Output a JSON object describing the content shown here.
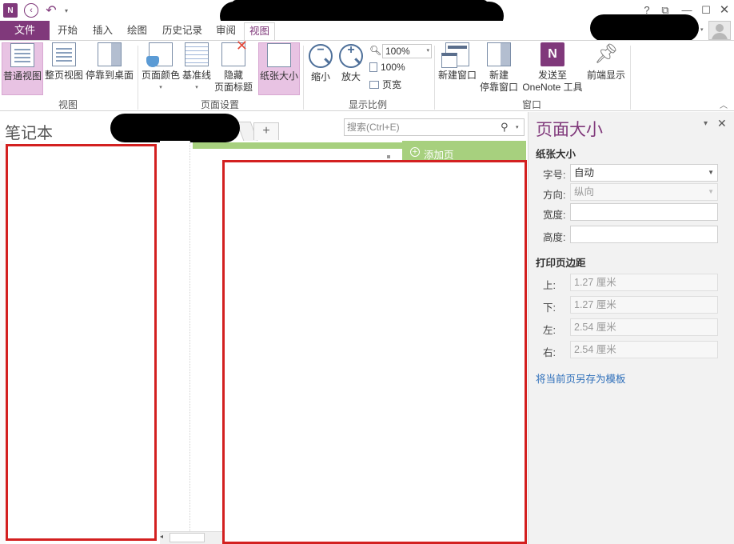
{
  "titlebar": {
    "app_logo": "N",
    "back_icon": "back-icon",
    "undo_icon": "undo-icon",
    "help": "?",
    "restore_ribbon": "⧉",
    "minimize": "—",
    "maximize": "☐",
    "close": "✕"
  },
  "tabs": {
    "file": "文件",
    "home": "开始",
    "insert": "插入",
    "draw": "绘图",
    "history": "历史记录",
    "review": "审阅",
    "view": "视图"
  },
  "ribbon": {
    "view_group": {
      "label": "视图",
      "normal_view": "普通视图",
      "full_page_view": "整页视图",
      "dock_to_desktop": "停靠到桌面"
    },
    "page_setup_group": {
      "label": "页面设置",
      "page_color": "页面颜色",
      "rule_lines": "基准线",
      "hide_title_line1": "隐藏",
      "hide_title_line2": "页面标题",
      "paper_size": "纸张大小"
    },
    "zoom_group": {
      "label": "显示比例",
      "zoom_out": "缩小",
      "zoom_in": "放大",
      "zoom_value": "100%",
      "zoom_100": "100%",
      "page_width": "页宽"
    },
    "window_group": {
      "label": "窗口",
      "new_window": "新建窗口",
      "new_docked_line1": "新建",
      "new_docked_line2": "停靠窗口",
      "send_to_line1": "发送至",
      "send_to_line2": "OneNote 工具",
      "always_on_top": "前端显示"
    }
  },
  "notebook": {
    "title": "笔记本",
    "add_section": "+",
    "search_placeholder": "搜索(Ctrl+E)",
    "add_page": "添加页"
  },
  "task_pane": {
    "title": "页面大小",
    "paper_size_section": "纸张大小",
    "size_label": "字号:",
    "size_value": "自动",
    "orientation_label": "方向:",
    "orientation_value": "纵向",
    "width_label": "宽度:",
    "width_value": "",
    "height_label": "高度:",
    "height_value": "",
    "margins_section": "打印页边距",
    "top_label": "上:",
    "top_value": "1.27 厘米",
    "bottom_label": "下:",
    "bottom_value": "1.27 厘米",
    "left_label": "左:",
    "left_value": "2.54 厘米",
    "right_label": "右:",
    "right_value": "2.54 厘米",
    "save_template": "将当前页另存为模板"
  },
  "colors": {
    "brand": "#80397b",
    "selected_button": "#e8c3e3",
    "section_green": "#a7d07e",
    "highlight_red": "#d32020",
    "link_blue": "#2e6fba"
  }
}
